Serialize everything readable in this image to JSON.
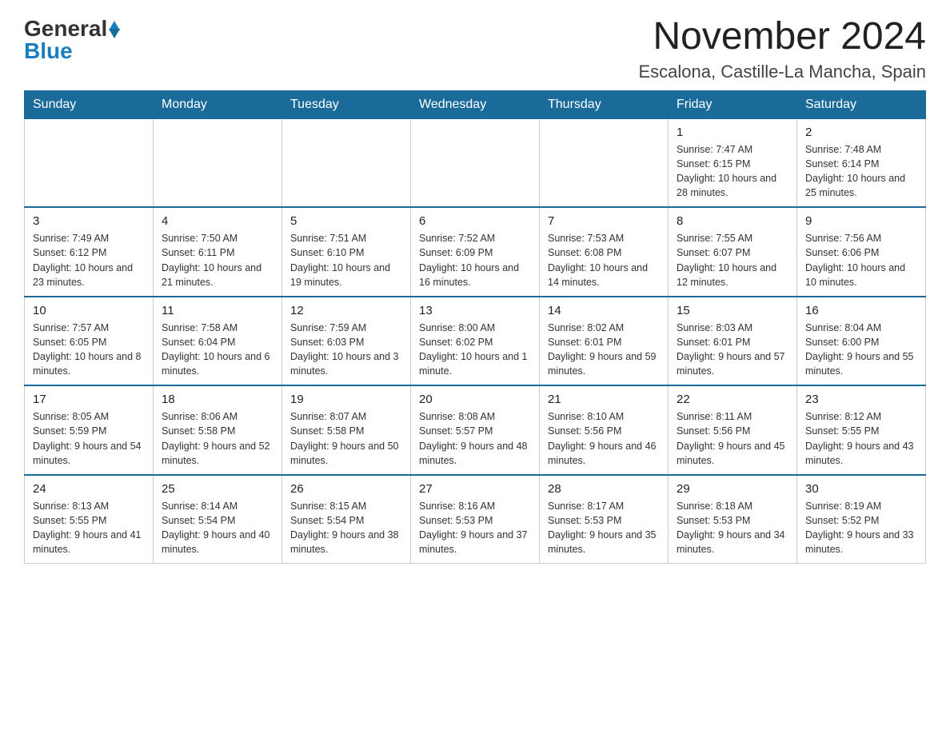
{
  "logo": {
    "general": "General",
    "blue": "Blue"
  },
  "title": "November 2024",
  "location": "Escalona, Castille-La Mancha, Spain",
  "weekdays": [
    "Sunday",
    "Monday",
    "Tuesday",
    "Wednesday",
    "Thursday",
    "Friday",
    "Saturday"
  ],
  "weeks": [
    [
      {
        "day": "",
        "info": ""
      },
      {
        "day": "",
        "info": ""
      },
      {
        "day": "",
        "info": ""
      },
      {
        "day": "",
        "info": ""
      },
      {
        "day": "",
        "info": ""
      },
      {
        "day": "1",
        "info": "Sunrise: 7:47 AM\nSunset: 6:15 PM\nDaylight: 10 hours and 28 minutes."
      },
      {
        "day": "2",
        "info": "Sunrise: 7:48 AM\nSunset: 6:14 PM\nDaylight: 10 hours and 25 minutes."
      }
    ],
    [
      {
        "day": "3",
        "info": "Sunrise: 7:49 AM\nSunset: 6:12 PM\nDaylight: 10 hours and 23 minutes."
      },
      {
        "day": "4",
        "info": "Sunrise: 7:50 AM\nSunset: 6:11 PM\nDaylight: 10 hours and 21 minutes."
      },
      {
        "day": "5",
        "info": "Sunrise: 7:51 AM\nSunset: 6:10 PM\nDaylight: 10 hours and 19 minutes."
      },
      {
        "day": "6",
        "info": "Sunrise: 7:52 AM\nSunset: 6:09 PM\nDaylight: 10 hours and 16 minutes."
      },
      {
        "day": "7",
        "info": "Sunrise: 7:53 AM\nSunset: 6:08 PM\nDaylight: 10 hours and 14 minutes."
      },
      {
        "day": "8",
        "info": "Sunrise: 7:55 AM\nSunset: 6:07 PM\nDaylight: 10 hours and 12 minutes."
      },
      {
        "day": "9",
        "info": "Sunrise: 7:56 AM\nSunset: 6:06 PM\nDaylight: 10 hours and 10 minutes."
      }
    ],
    [
      {
        "day": "10",
        "info": "Sunrise: 7:57 AM\nSunset: 6:05 PM\nDaylight: 10 hours and 8 minutes."
      },
      {
        "day": "11",
        "info": "Sunrise: 7:58 AM\nSunset: 6:04 PM\nDaylight: 10 hours and 6 minutes."
      },
      {
        "day": "12",
        "info": "Sunrise: 7:59 AM\nSunset: 6:03 PM\nDaylight: 10 hours and 3 minutes."
      },
      {
        "day": "13",
        "info": "Sunrise: 8:00 AM\nSunset: 6:02 PM\nDaylight: 10 hours and 1 minute."
      },
      {
        "day": "14",
        "info": "Sunrise: 8:02 AM\nSunset: 6:01 PM\nDaylight: 9 hours and 59 minutes."
      },
      {
        "day": "15",
        "info": "Sunrise: 8:03 AM\nSunset: 6:01 PM\nDaylight: 9 hours and 57 minutes."
      },
      {
        "day": "16",
        "info": "Sunrise: 8:04 AM\nSunset: 6:00 PM\nDaylight: 9 hours and 55 minutes."
      }
    ],
    [
      {
        "day": "17",
        "info": "Sunrise: 8:05 AM\nSunset: 5:59 PM\nDaylight: 9 hours and 54 minutes."
      },
      {
        "day": "18",
        "info": "Sunrise: 8:06 AM\nSunset: 5:58 PM\nDaylight: 9 hours and 52 minutes."
      },
      {
        "day": "19",
        "info": "Sunrise: 8:07 AM\nSunset: 5:58 PM\nDaylight: 9 hours and 50 minutes."
      },
      {
        "day": "20",
        "info": "Sunrise: 8:08 AM\nSunset: 5:57 PM\nDaylight: 9 hours and 48 minutes."
      },
      {
        "day": "21",
        "info": "Sunrise: 8:10 AM\nSunset: 5:56 PM\nDaylight: 9 hours and 46 minutes."
      },
      {
        "day": "22",
        "info": "Sunrise: 8:11 AM\nSunset: 5:56 PM\nDaylight: 9 hours and 45 minutes."
      },
      {
        "day": "23",
        "info": "Sunrise: 8:12 AM\nSunset: 5:55 PM\nDaylight: 9 hours and 43 minutes."
      }
    ],
    [
      {
        "day": "24",
        "info": "Sunrise: 8:13 AM\nSunset: 5:55 PM\nDaylight: 9 hours and 41 minutes."
      },
      {
        "day": "25",
        "info": "Sunrise: 8:14 AM\nSunset: 5:54 PM\nDaylight: 9 hours and 40 minutes."
      },
      {
        "day": "26",
        "info": "Sunrise: 8:15 AM\nSunset: 5:54 PM\nDaylight: 9 hours and 38 minutes."
      },
      {
        "day": "27",
        "info": "Sunrise: 8:16 AM\nSunset: 5:53 PM\nDaylight: 9 hours and 37 minutes."
      },
      {
        "day": "28",
        "info": "Sunrise: 8:17 AM\nSunset: 5:53 PM\nDaylight: 9 hours and 35 minutes."
      },
      {
        "day": "29",
        "info": "Sunrise: 8:18 AM\nSunset: 5:53 PM\nDaylight: 9 hours and 34 minutes."
      },
      {
        "day": "30",
        "info": "Sunrise: 8:19 AM\nSunset: 5:52 PM\nDaylight: 9 hours and 33 minutes."
      }
    ]
  ]
}
